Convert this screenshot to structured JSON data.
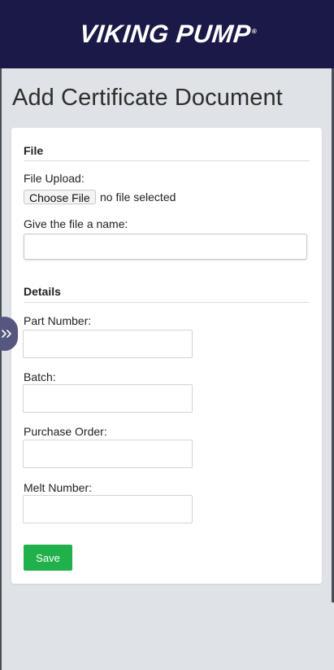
{
  "header": {
    "logo_text": "VIKING PUMP",
    "logo_mark": "®"
  },
  "page": {
    "title": "Add Certificate Document"
  },
  "file_section": {
    "heading": "File",
    "upload_label": "File Upload:",
    "choose_button_label": "Choose File",
    "no_file_text": "no file selected",
    "name_label": "Give the file a name:",
    "name_value": ""
  },
  "details_section": {
    "heading": "Details",
    "part_number_label": "Part Number:",
    "part_number_value": "",
    "batch_label": "Batch:",
    "batch_value": "",
    "purchase_order_label": "Purchase Order:",
    "purchase_order_value": "",
    "melt_number_label": "Melt Number:",
    "melt_number_value": ""
  },
  "actions": {
    "save_label": "Save"
  },
  "drawer": {
    "icon": "double-chevron-right-icon"
  },
  "colors": {
    "header_bg": "#1a1947",
    "page_bg": "#dfe2e6",
    "save_button": "#21b14a",
    "drawer_toggle": "#54577e"
  }
}
